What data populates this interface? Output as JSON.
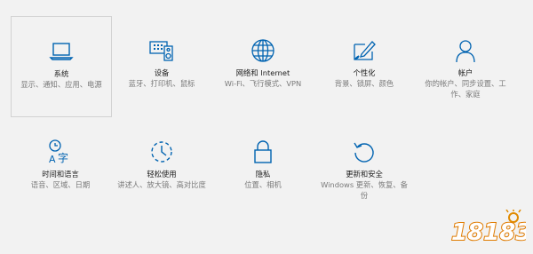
{
  "tiles": [
    {
      "title": "系统",
      "desc": "显示、通知、应用、电源",
      "icon": "monitor-icon"
    },
    {
      "title": "设备",
      "desc": "蓝牙、打印机、鼠标",
      "icon": "devices-icon"
    },
    {
      "title": "网络和 Internet",
      "desc": "Wi-Fi、飞行模式、VPN",
      "icon": "globe-icon"
    },
    {
      "title": "个性化",
      "desc": "背景、锁屏、颜色",
      "icon": "personalization-icon"
    },
    {
      "title": "帐户",
      "desc": "你的帐户、同步设置、工作、家庭",
      "icon": "person-icon"
    },
    {
      "title": "时间和语言",
      "desc": "语音、区域、日期",
      "icon": "time-language-icon"
    },
    {
      "title": "轻松使用",
      "desc": "讲述人、放大镜、高对比度",
      "icon": "ease-of-access-icon"
    },
    {
      "title": "隐私",
      "desc": "位置、相机",
      "icon": "lock-icon"
    },
    {
      "title": "更新和安全",
      "desc": "Windows 更新、恢复、备份",
      "icon": "update-icon"
    }
  ],
  "watermark": {
    "text": "18183",
    "icon": "18183-logo"
  },
  "colors": {
    "accent": "#0063b1",
    "background": "#f2f2f2",
    "selected_border": "#d2d2d2"
  }
}
